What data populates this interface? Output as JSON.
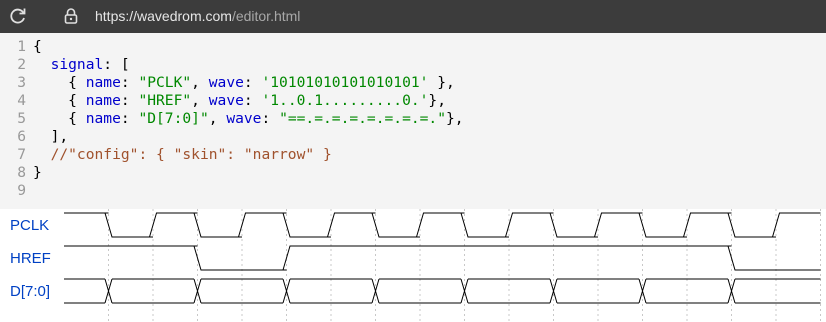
{
  "browser": {
    "url_host": "https://wavedrom.com",
    "url_path": "/editor.html"
  },
  "editor": {
    "lines": [
      {
        "n": "1",
        "parts": [
          [
            "p",
            "{"
          ]
        ]
      },
      {
        "n": "2",
        "parts": [
          [
            "p",
            "  "
          ],
          [
            "k",
            "signal"
          ],
          [
            "p",
            ": ["
          ]
        ]
      },
      {
        "n": "3",
        "parts": [
          [
            "p",
            "    { "
          ],
          [
            "k",
            "name"
          ],
          [
            "p",
            ": "
          ],
          [
            "s",
            "\"PCLK\""
          ],
          [
            "p",
            ", "
          ],
          [
            "k",
            "wave"
          ],
          [
            "p",
            ": "
          ],
          [
            "s",
            "'10101010101010101'"
          ],
          [
            "p",
            " },"
          ]
        ]
      },
      {
        "n": "4",
        "parts": [
          [
            "p",
            "    { "
          ],
          [
            "k",
            "name"
          ],
          [
            "p",
            ": "
          ],
          [
            "s",
            "\"HREF\""
          ],
          [
            "p",
            ", "
          ],
          [
            "k",
            "wave"
          ],
          [
            "p",
            ": "
          ],
          [
            "s",
            "'1..0.1.........0.'"
          ],
          [
            "p",
            "},"
          ]
        ]
      },
      {
        "n": "5",
        "parts": [
          [
            "p",
            "    { "
          ],
          [
            "k",
            "name"
          ],
          [
            "p",
            ": "
          ],
          [
            "s",
            "\"D[7:0]\""
          ],
          [
            "p",
            ", "
          ],
          [
            "k",
            "wave"
          ],
          [
            "p",
            ": "
          ],
          [
            "s",
            "\"==.=.=.=.=.=.=.=.\""
          ],
          [
            "p",
            "},"
          ]
        ]
      },
      {
        "n": "6",
        "parts": [
          [
            "p",
            "  ],"
          ]
        ]
      },
      {
        "n": "7",
        "parts": [
          [
            "p",
            "  "
          ],
          [
            "c",
            "//\"config\": { \"skin\": \"narrow\" }"
          ]
        ]
      },
      {
        "n": "8",
        "parts": [
          [
            "p",
            "}"
          ]
        ]
      },
      {
        "n": "9",
        "parts": []
      }
    ]
  },
  "waveform": {
    "signals": [
      {
        "name": "PCLK",
        "wave": "10101010101010101"
      },
      {
        "name": "HREF",
        "wave": "1..0.1.........0."
      },
      {
        "name": "D[7:0]",
        "wave": "==.=.=.=.=.=.=.=."
      }
    ]
  }
}
